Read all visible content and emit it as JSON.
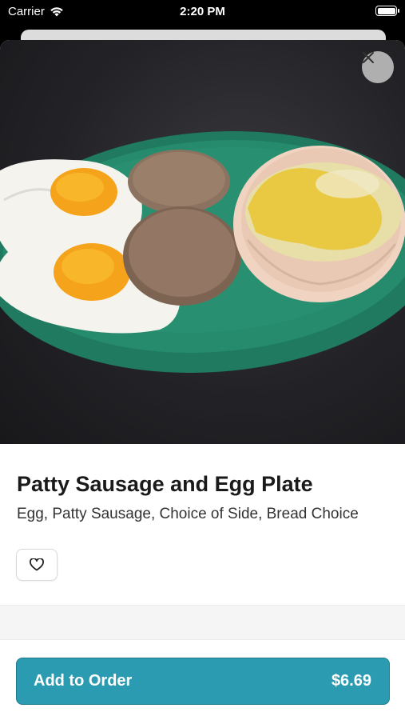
{
  "status_bar": {
    "carrier": "Carrier",
    "time": "2:20 PM"
  },
  "item": {
    "title": "Patty Sausage and Egg Plate",
    "description": "Egg, Patty Sausage, Choice of Side, Bread Choice"
  },
  "actions": {
    "add_to_order_label": "Add to Order",
    "price": "$6.69"
  },
  "colors": {
    "accent": "#2a9bb0",
    "background": "#ffffff"
  },
  "icons": {
    "close": "close-icon",
    "favorite": "heart-icon",
    "wifi": "wifi-icon",
    "battery": "battery-icon"
  }
}
